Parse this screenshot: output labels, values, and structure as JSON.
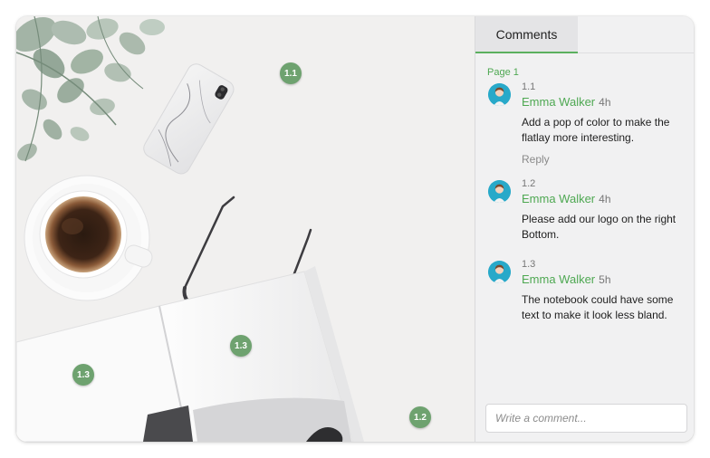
{
  "tabs": {
    "comments": "Comments"
  },
  "page_label": "Page 1",
  "pins": [
    "1.1",
    "1.3",
    "1.3",
    "1.2"
  ],
  "comments": [
    {
      "number": "1.1",
      "author": "Emma Walker",
      "time": "4h",
      "text": "Add a pop of color to make the flatlay more interesting.",
      "reply": "Reply"
    },
    {
      "number": "1.2",
      "author": "Emma Walker",
      "time": "4h",
      "text": "Please add our logo on the right Bottom."
    },
    {
      "number": "1.3",
      "author": "Emma Walker",
      "time": "5h",
      "text": "The notebook could have some text to make it look less bland."
    }
  ],
  "composer": {
    "placeholder": "Write a comment..."
  },
  "colors": {
    "accent": "#4ea852",
    "pin": "#6ea26f",
    "avatar": "#28a9c9"
  },
  "icons": [
    "avatar"
  ]
}
